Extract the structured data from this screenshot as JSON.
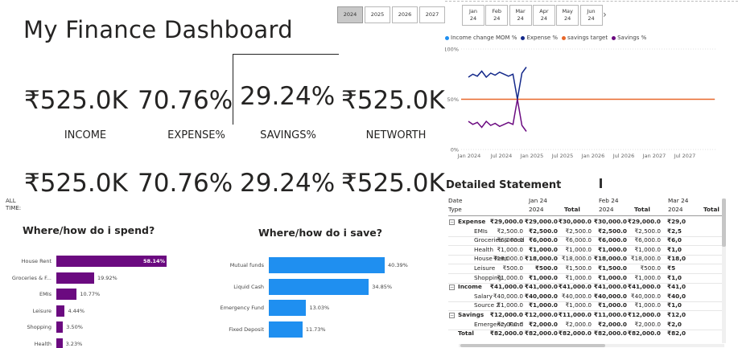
{
  "title": "My Finance Dashboard",
  "year_slicer": [
    {
      "label": "2024",
      "selected": true
    },
    {
      "label": "2025",
      "selected": false
    },
    {
      "label": "2026",
      "selected": false
    },
    {
      "label": "2027",
      "selected": false
    }
  ],
  "month_slicer": [
    {
      "month": "Jan",
      "year": "24"
    },
    {
      "month": "Feb",
      "year": "24"
    },
    {
      "month": "Mar",
      "year": "24"
    },
    {
      "month": "Apr",
      "year": "24"
    },
    {
      "month": "May",
      "year": "24"
    },
    {
      "month": "Jun",
      "year": "24"
    }
  ],
  "kpis_period": {
    "income": "₹525.0K",
    "expense_pct": "70.76%",
    "savings_pct": "29.24%",
    "networth": "₹525.0K"
  },
  "kpi_labels": {
    "income": "INCOME",
    "expense": "EXPENSE%",
    "savings": "SAVINGS%",
    "networth": "NETWORTH"
  },
  "kpis_all_time": {
    "label": "ALL TIME:",
    "income": "₹525.0K",
    "expense_pct": "70.76%",
    "savings_pct": "29.24%",
    "networth": "₹525.0K"
  },
  "colors": {
    "spend_bar": "#6b0a80",
    "save_bar": "#1f8ff0",
    "income_change": "#1f8ff0",
    "expense_line": "#13288a",
    "savings_target": "#e8682a",
    "savings_line": "#6b0a80"
  },
  "chart_data": [
    {
      "type": "bar",
      "title": "Where/how do i spend?",
      "categories": [
        "House Rent",
        "Groceries & F...",
        "EMIs",
        "Leisure",
        "Shopping",
        "Health"
      ],
      "values": [
        58.14,
        19.92,
        10.77,
        4.44,
        3.5,
        3.23
      ],
      "value_labels": [
        "58.14%",
        "19.92%",
        "10.77%",
        "4.44%",
        "3.50%",
        "3.23%"
      ]
    },
    {
      "type": "bar",
      "title": "Where/how do i save?",
      "categories": [
        "Mutual funds",
        "Liquid Cash",
        "Emergency Fund",
        "Fixed Deposit"
      ],
      "values": [
        40.39,
        34.85,
        13.03,
        11.73
      ],
      "value_labels": [
        "40.39%",
        "34.85%",
        "13.03%",
        "11.73%"
      ]
    },
    {
      "type": "line",
      "legend": [
        "Income change MOM %",
        "Expense %",
        "savings target",
        "Savings %"
      ],
      "y_ticks": [
        "0%",
        "50%",
        "100%"
      ],
      "x_ticks": [
        "Jan 2024",
        "Jul 2024",
        "Jan 2025",
        "Jul 2025",
        "Jan 2026",
        "Jul 2026",
        "Jan 2027",
        "Jul 2027"
      ],
      "ylim": [
        0,
        100
      ],
      "series": [
        {
          "name": "Expense %",
          "values": [
            72,
            75,
            73,
            78,
            72,
            76,
            74,
            77,
            75,
            73,
            75,
            50,
            76,
            82
          ]
        },
        {
          "name": "Savings %",
          "values": [
            28,
            25,
            27,
            22,
            28,
            24,
            26,
            23,
            25,
            27,
            25,
            50,
            24,
            18
          ]
        },
        {
          "name": "savings target",
          "values": [
            50,
            50
          ]
        }
      ]
    }
  ],
  "statement": {
    "title": "Detailed Statement",
    "header_row1": [
      "Date",
      "Jan 24",
      "",
      "Feb 24",
      "",
      "Mar 24",
      ""
    ],
    "header_row2": [
      "Type",
      "2024",
      "Total",
      "2024",
      "Total",
      "2024",
      "Total"
    ],
    "rows": [
      {
        "label": "Expense",
        "level": 0,
        "values": [
          "₹29,000.0",
          "₹29,000.0",
          "₹30,000.0",
          "₹30,000.0",
          "₹29,000.0",
          "₹29,0"
        ]
      },
      {
        "label": "EMIs",
        "level": 1,
        "values": [
          "₹2,500.0",
          "₹2,500.0",
          "₹2,500.0",
          "₹2,500.0",
          "₹2,500.0",
          "₹2,5"
        ]
      },
      {
        "label": "Groceries & Food",
        "level": 1,
        "values": [
          "₹6,000.0",
          "₹6,000.0",
          "₹6,000.0",
          "₹6,000.0",
          "₹6,000.0",
          "₹6,0"
        ]
      },
      {
        "label": "Health",
        "level": 1,
        "values": [
          "₹1,000.0",
          "₹1,000.0",
          "₹1,000.0",
          "₹1,000.0",
          "₹1,000.0",
          "₹1,0"
        ]
      },
      {
        "label": "House Rent",
        "level": 1,
        "values": [
          "₹18,000.0",
          "₹18,000.0",
          "₹18,000.0",
          "₹18,000.0",
          "₹18,000.0",
          "₹18,0"
        ]
      },
      {
        "label": "Leisure",
        "level": 1,
        "values": [
          "₹500.0",
          "₹500.0",
          "₹1,500.0",
          "₹1,500.0",
          "₹500.0",
          "₹5"
        ]
      },
      {
        "label": "Shopping",
        "level": 1,
        "values": [
          "₹1,000.0",
          "₹1,000.0",
          "₹1,000.0",
          "₹1,000.0",
          "₹1,000.0",
          "₹1,0"
        ]
      },
      {
        "label": "Income",
        "level": 0,
        "values": [
          "₹41,000.0",
          "₹41,000.0",
          "₹41,000.0",
          "₹41,000.0",
          "₹41,000.0",
          "₹41,0"
        ]
      },
      {
        "label": "Salary",
        "level": 1,
        "values": [
          "₹40,000.0",
          "₹40,000.0",
          "₹40,000.0",
          "₹40,000.0",
          "₹40,000.0",
          "₹40,0"
        ]
      },
      {
        "label": "Source 2",
        "level": 1,
        "values": [
          "₹1,000.0",
          "₹1,000.0",
          "₹1,000.0",
          "₹1,000.0",
          "₹1,000.0",
          "₹1,0"
        ]
      },
      {
        "label": "Savings",
        "level": 0,
        "values": [
          "₹12,000.0",
          "₹12,000.0",
          "₹11,000.0",
          "₹11,000.0",
          "₹12,000.0",
          "₹12,0"
        ]
      },
      {
        "label": "Emergency Fund",
        "level": 1,
        "values": [
          "₹2,000.0",
          "₹2,000.0",
          "₹2,000.0",
          "₹2,000.0",
          "₹2,000.0",
          "₹2,0"
        ]
      },
      {
        "label": "Total",
        "level": -1,
        "values": [
          "₹82,000.0",
          "₹82,000.0",
          "₹82,000.0",
          "₹82,000.0",
          "₹82,000.0",
          "₹82,0"
        ]
      }
    ]
  }
}
